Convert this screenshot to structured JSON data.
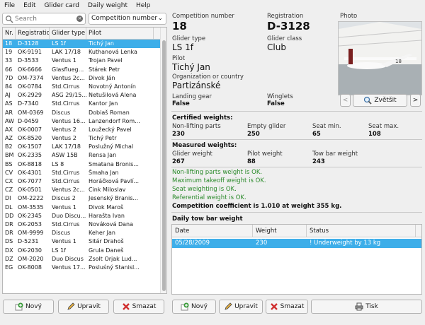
{
  "menu": [
    "File",
    "Edit",
    "Glider card",
    "Daily weight",
    "Help"
  ],
  "search": {
    "placeholder": "Search"
  },
  "filter": {
    "selected": "Competition number"
  },
  "list": {
    "headers": [
      "Nr.",
      "Registration",
      "Glider type",
      "Pilot"
    ],
    "rows": [
      [
        "18",
        "D-3128",
        "LS 1f",
        "Tichý Jan"
      ],
      [
        "19",
        "OK-9191",
        "LAK 17/18",
        "Kuthanová Lenka"
      ],
      [
        "33",
        "D-3533",
        "Ventus 1",
        "Trojan Pavel"
      ],
      [
        "66",
        "OK-6666",
        "Glasflueg...",
        "Stárek Petr"
      ],
      [
        "7D",
        "OM-7374",
        "Ventus 2c...",
        "Divok Ján"
      ],
      [
        "84",
        "OK-0784",
        "Std.Cirrus",
        "Novotný Antonín"
      ],
      [
        "AJ",
        "OK-2929",
        "ASG 29/15...",
        "Netušilová Alena"
      ],
      [
        "AS",
        "D-7340",
        "Std.Cirrus",
        "Kantor Jan"
      ],
      [
        "AR",
        "OM-0369",
        "Discus",
        "Dobiaš Roman"
      ],
      [
        "AW",
        "D-0459",
        "Ventus 16...",
        "Lanzendorf Rom..."
      ],
      [
        "AX",
        "OK-0007",
        "Ventus 2",
        "Loužecký Pavel"
      ],
      [
        "AZ",
        "OK-8520",
        "Ventus 2",
        "Tichý Petr"
      ],
      [
        "B2",
        "OK-1507",
        "LAK 17/18",
        "Poslužný Michal"
      ],
      [
        "BM",
        "OK-2335",
        "ASW 15B",
        "Rensa Jan"
      ],
      [
        "BS",
        "OK-8818",
        "LS 8",
        "Smatana Bronis..."
      ],
      [
        "CV",
        "OK-4301",
        "Std.Cirrus",
        "Šmaha Jan"
      ],
      [
        "CX",
        "OK-7077",
        "Std.Cirrus",
        "Horáčková Pavlí..."
      ],
      [
        "CZ",
        "OK-0501",
        "Ventus 2c...",
        "Cink Miloslav"
      ],
      [
        "DI",
        "OM-2222",
        "Discus 2",
        "Jesenský Branis..."
      ],
      [
        "DL",
        "OM-3535",
        "Ventus 1",
        "Divok Maroš"
      ],
      [
        "DD",
        "OK-2345",
        "Duo Discu...",
        "Harašta Ivan"
      ],
      [
        "DR",
        "OK-2053",
        "Std.Cirrus",
        "Nováková Dana"
      ],
      [
        "DR",
        "OM-9999",
        "Discus",
        "Keher Jan"
      ],
      [
        "DS",
        "D-5231",
        "Ventus 1",
        "Sitár Drahoš"
      ],
      [
        "DX",
        "OK-2030",
        "LS 1f",
        "Grula Daneš"
      ],
      [
        "DZ",
        "OM-2020",
        "Duo Discus",
        "Zsolt Orjak Lud..."
      ],
      [
        "EG",
        "OK-8008",
        "Ventus 17...",
        "Posluśný Stanisl..."
      ]
    ]
  },
  "detail": {
    "comp_label": "Competition number",
    "comp": "18",
    "reg_label": "Registration",
    "reg": "D-3128",
    "type_label": "Glider type",
    "type": "LS 1f",
    "class_label": "Glider class",
    "class": "Club",
    "pilot_label": "Pilot",
    "pilot": "Tichý Jan",
    "org_label": "Organization or country",
    "org": "Partizánské",
    "gear_label": "Landing gear",
    "gear": "False",
    "winglets_label": "Winglets",
    "winglets": "False"
  },
  "photo": {
    "label": "Photo",
    "zoom": "Zvětšit",
    "prev": "<",
    "next": ">"
  },
  "certified": {
    "title": "Certified weights:",
    "labels": [
      "Non-lifting parts",
      "Empty glider",
      "Seat min.",
      "Seat max."
    ],
    "values": [
      "230",
      "250",
      "65",
      "108"
    ]
  },
  "measured": {
    "title": "Measured weights:",
    "labels": [
      "Glider weight",
      "Pilot weight",
      "Tow bar weight"
    ],
    "values": [
      "267",
      "88",
      "243"
    ]
  },
  "checks": [
    "Non-lifting parts weight is OK.",
    "Maximum takeoff weight is OK.",
    "Seat weighting is OK.",
    "Referential weight is OK."
  ],
  "coefficient": "Competition coefficient is 1.010 at weight 355 kg.",
  "tow": {
    "title": "Daily tow bar weight",
    "headers": [
      "Date",
      "Weight",
      "Status"
    ],
    "row": [
      "05/28/2009",
      "230",
      "! Underweight by 13 kg"
    ]
  },
  "buttons": {
    "new": "Nový",
    "edit": "Upravit",
    "delete": "Smazat",
    "print": "Tisk"
  },
  "colors": {
    "selection": "#3daee9",
    "ok": "#2a8a2a"
  }
}
